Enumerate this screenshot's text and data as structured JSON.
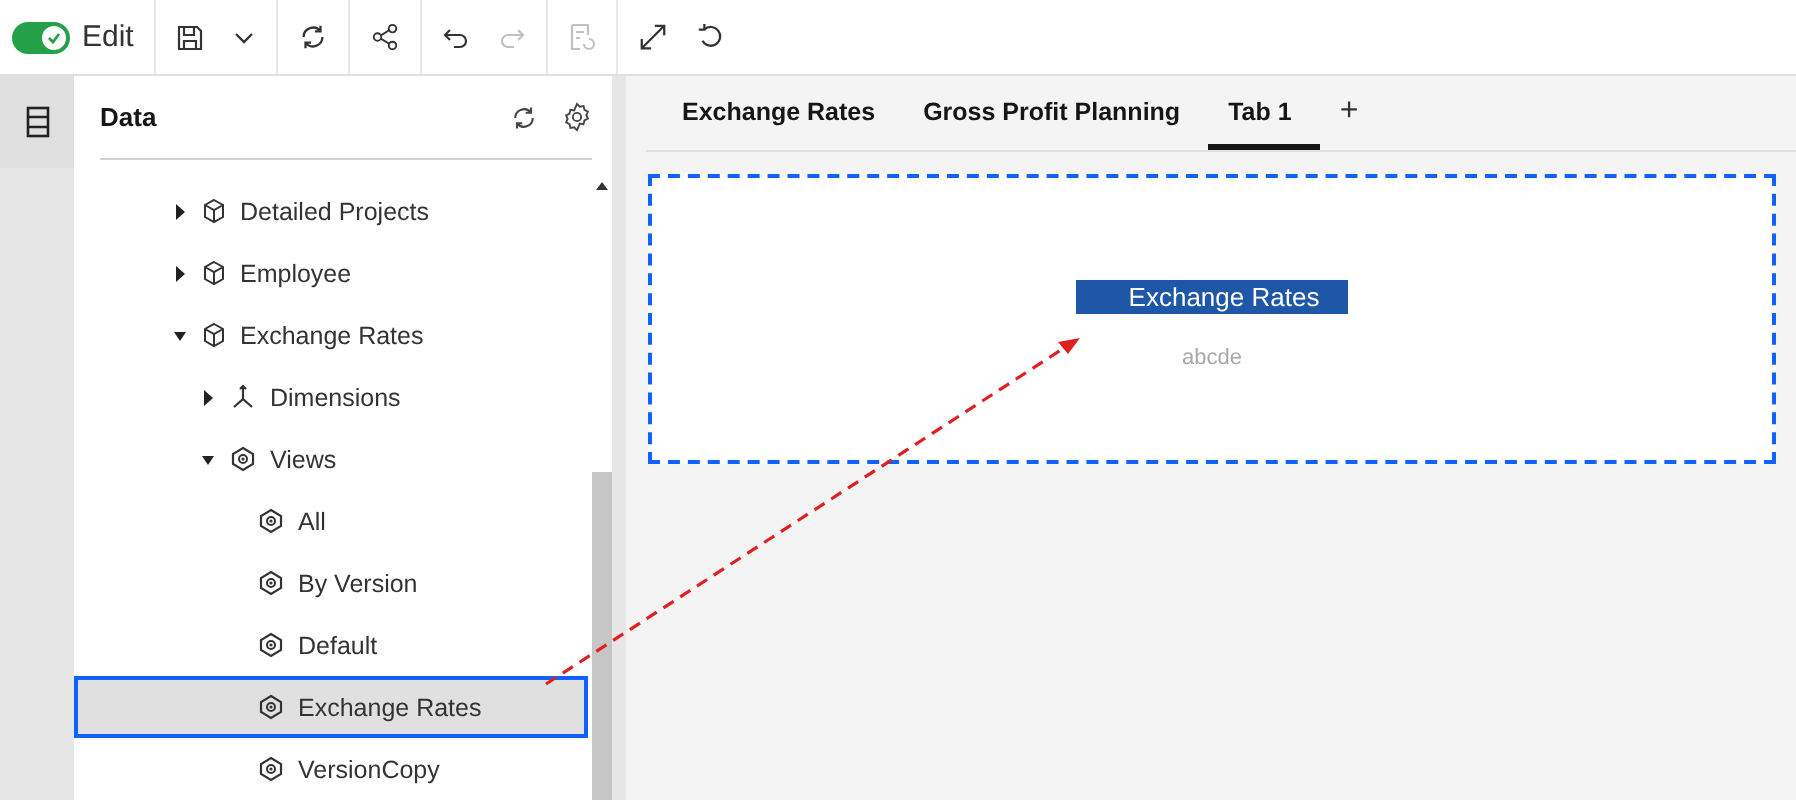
{
  "toolbar": {
    "edit_toggle": {
      "label": "Edit",
      "on": true
    },
    "redo_disabled": true,
    "page_disabled": true
  },
  "data_panel": {
    "title": "Data",
    "tree": [
      {
        "label": "Detailed Projects",
        "kind": "cube",
        "expanded": false,
        "selected": false
      },
      {
        "label": "Employee",
        "kind": "cube",
        "expanded": false,
        "selected": false
      },
      {
        "label": "Exchange Rates",
        "kind": "cube",
        "expanded": true,
        "selected": false,
        "children": [
          {
            "label": "Dimensions",
            "kind": "dimensions",
            "expanded": false,
            "selected": false
          },
          {
            "label": "Views",
            "kind": "view",
            "expanded": true,
            "selected": false,
            "children": [
              {
                "label": "All",
                "kind": "view",
                "selected": false
              },
              {
                "label": "By Version",
                "kind": "view",
                "selected": false
              },
              {
                "label": "Default",
                "kind": "view",
                "selected": false
              },
              {
                "label": "Exchange Rates",
                "kind": "view",
                "selected": true
              },
              {
                "label": "VersionCopy",
                "kind": "view",
                "selected": false
              }
            ]
          }
        ]
      }
    ]
  },
  "tabs": [
    {
      "label": "Exchange Rates",
      "selected": false
    },
    {
      "label": "Gross Profit Planning",
      "selected": false
    },
    {
      "label": "Tab 1",
      "selected": true
    }
  ],
  "add_tab": "+",
  "drop_zone": {
    "drag_label": "Exchange Rates",
    "caption": "abcde"
  }
}
